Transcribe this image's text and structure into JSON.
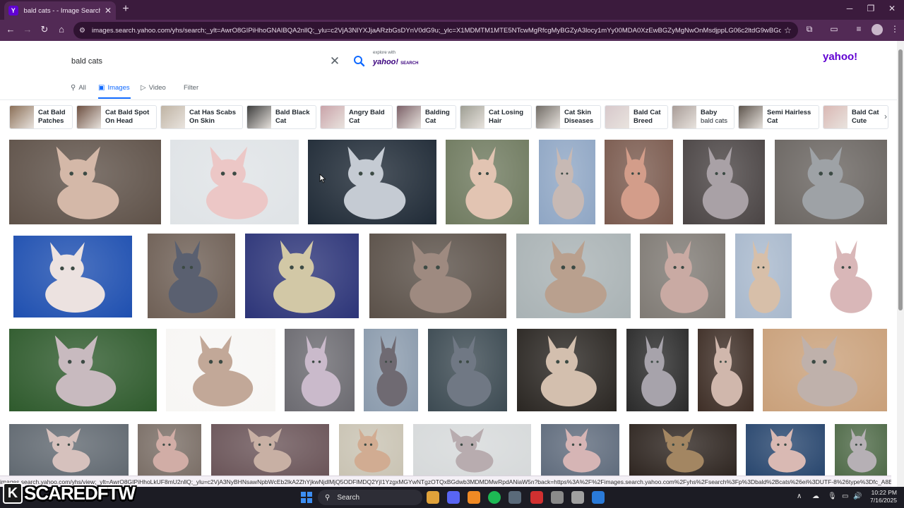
{
  "browser": {
    "tab_title": "bald cats - - Image Search Results",
    "favicon_letter": "Y",
    "url": "images.search.yahoo.com/yhs/search;_ylt=AwrO8GIPiHhoGNAIBQA2nllQ;_ylu=c2VjA3NlYXJjaARzbGsDYnV0dG9u;_ylc=X1MDMTM1MTE5NTcwMgRfcgMyBGZyA3locy1mYy00MDA0XzEwBGZyMgNwOnMsdjppLG06c2ltdG9wBGdwcmlkA...",
    "new_tab_label": "+",
    "window_controls": [
      "minimize-icon",
      "restore-icon",
      "close-icon"
    ]
  },
  "search": {
    "query": "bald cats",
    "clear_icon": "close-icon",
    "submit_icon": "search-icon",
    "explore_small": "explore with",
    "explore_brand": "yahoo!",
    "explore_brand_suffix": "SEARCH",
    "logo": "yahoo!"
  },
  "filters": [
    {
      "label": "All",
      "icon": "search-icon",
      "active": false
    },
    {
      "label": "Images",
      "icon": "image-icon",
      "active": true
    },
    {
      "label": "Video",
      "icon": "play-icon",
      "active": false
    },
    {
      "label": "Filter",
      "icon": "",
      "active": false
    }
  ],
  "chips": [
    {
      "line1": "Cat Bald",
      "line2": "Patches",
      "color": "#8a6e56"
    },
    {
      "line1": "Cat Bald Spot",
      "line2": "On Head",
      "color": "#6b4d3e"
    },
    {
      "line1": "Cat Has Scabs",
      "line2": "On Skin",
      "color": "#bfb3a3"
    },
    {
      "line1": "Bald Black",
      "line2": "Cat",
      "color": "#3a3a3a"
    },
    {
      "line1": "Angry Bald",
      "line2": "Cat",
      "color": "#c9a2a8"
    },
    {
      "line1": "Balding",
      "line2": "Cat",
      "color": "#7a5f66"
    },
    {
      "line1": "Cat Losing",
      "line2": "Hair",
      "color": "#9d9d92"
    },
    {
      "line1": "Cat Skin",
      "line2": "Diseases",
      "color": "#6f6a64"
    },
    {
      "line1": "Bald Cat",
      "line2": "Breed",
      "color": "#d7c8cb"
    },
    {
      "line1": "Baby",
      "line2": "bald cats",
      "color": "#a79b96",
      "line2_normal": true
    },
    {
      "line1": "Semi Hairless",
      "line2": "Cat",
      "color": "#5b524a"
    },
    {
      "line1": "Bald Cat",
      "line2": "Cute",
      "color": "#d9b7b3"
    }
  ],
  "chips_next_icon": "chevron-right-icon",
  "images": [
    {
      "name": "image-sphynx-1",
      "bg": "#5e5148",
      "cat": "#d4b8a8"
    },
    {
      "name": "image-sphynx-2",
      "bg": "#dfe3e6",
      "cat": "#ecc7c6"
    },
    {
      "name": "image-sphynx-3",
      "bg": "#1f2a36",
      "cat": "#c5cbd3"
    },
    {
      "name": "image-sphynx-4",
      "bg": "#6f7a5f",
      "cat": "#e2c4b2"
    },
    {
      "name": "image-sphynx-5",
      "bg": "#8fa6c4",
      "cat": "#c7b9b4"
    },
    {
      "name": "image-sphynx-6",
      "bg": "#7a5a4e",
      "cat": "#d39d8a"
    },
    {
      "name": "image-sphynx-7",
      "bg": "#4a4444",
      "cat": "#a9a1a6"
    },
    {
      "name": "image-sphynx-8",
      "bg": "#6a6561",
      "cat": "#9ea2a6"
    },
    {
      "name": "image-sphynx-9",
      "bg": "#1e4fb0",
      "cat": "#ece2e0"
    },
    {
      "name": "image-sphynx-10",
      "bg": "#6e5f55",
      "cat": "#5a6070"
    },
    {
      "name": "image-sphynx-11",
      "bg": "#2c3478",
      "cat": "#d2c8a6"
    },
    {
      "name": "image-sphynx-12",
      "bg": "#5a5048",
      "cat": "#9e8a80"
    },
    {
      "name": "image-sphynx-13",
      "bg": "#a9b2b4",
      "cat": "#b9a08e"
    },
    {
      "name": "image-sphynx-14",
      "bg": "#7f7a74",
      "cat": "#c9aaa3"
    },
    {
      "name": "image-sphynx-15",
      "bg": "#a8b8cc",
      "cat": "#d7bfa9"
    },
    {
      "name": "image-sphynx-16",
      "bg": "#ffffff",
      "cat": "#d9b7b8"
    },
    {
      "name": "image-sphynx-17",
      "bg": "#2e5a2c",
      "cat": "#c8babf"
    },
    {
      "name": "image-sphynx-18",
      "bg": "#f7f6f4",
      "cat": "#c2a898"
    },
    {
      "name": "image-sphynx-19",
      "bg": "#6b6a70",
      "cat": "#cabacb"
    },
    {
      "name": "image-sphynx-20",
      "bg": "#8a9aac",
      "cat": "#6f6a72"
    },
    {
      "name": "image-sphynx-21",
      "bg": "#3c4a52",
      "cat": "#707884"
    },
    {
      "name": "image-sphynx-22",
      "bg": "#2a2622",
      "cat": "#d3bfae"
    },
    {
      "name": "image-sphynx-23",
      "bg": "#2a2a2a",
      "cat": "#a7a3ab"
    },
    {
      "name": "image-sphynx-24",
      "bg": "#3e2e26",
      "cat": "#d0b7ac"
    },
    {
      "name": "image-sphynx-25",
      "bg": "#c9a07a",
      "cat": "#bfb1ab"
    },
    {
      "name": "image-sphynx-26",
      "bg": "#606870",
      "cat": "#d6c1bd"
    },
    {
      "name": "image-sphynx-27",
      "bg": "#7a6e66",
      "cat": "#d1ada6"
    },
    {
      "name": "image-sphynx-28",
      "bg": "#6a5458",
      "cat": "#c8b0a4"
    },
    {
      "name": "image-sphynx-29",
      "bg": "#c9c3b3",
      "cat": "#d1ac92"
    },
    {
      "name": "image-sphynx-30",
      "bg": "#d6d9da",
      "cat": "#b8acaf"
    },
    {
      "name": "image-sphynx-31",
      "bg": "#5f6b7c",
      "cat": "#d6b5b5"
    },
    {
      "name": "image-sphynx-32",
      "bg": "#2e2520",
      "cat": "#a38662"
    },
    {
      "name": "image-sphynx-33",
      "bg": "#28466e",
      "cat": "#d9b9b3"
    },
    {
      "name": "image-sphynx-34",
      "bg": "#4f6a48",
      "cat": "#b6b0b5"
    }
  ],
  "status_url": "images.search.yahoo.com/yhs/view;_ylt=AwrO8GIPiHhoLkUF8mU2nllQ;_ylu=c2VjA3NyBHNsawNpbWcEb2lkA2ZhYjkwNjdlMjQ5ODFlMDQ2YjI1YzgxMGYwNTgzOTQxBGdwb3MDMDMwRpdANiaW5n?back=https%3A%2F%2Fimages.search.yahoo.com%2Fyhs%2Fsearch%3Fp%3Dbald%2Bcats%26ei%3DUTF-8%26type%3Dfc_A8E8726288_s58_g_e_d_n...",
  "watermark": {
    "badge": "K",
    "text": "SCAREDFTW"
  },
  "taskbar": {
    "search_label": "Search",
    "time": "10:22 PM",
    "date": "7/16/2025",
    "apps": [
      {
        "name": "chrome-icon",
        "color": "#e0a23a"
      },
      {
        "name": "discord-icon",
        "color": "#5865f2"
      },
      {
        "name": "app-orange-icon",
        "color": "#f08a24"
      },
      {
        "name": "spotify-icon",
        "color": "#1db954"
      },
      {
        "name": "steam-icon",
        "color": "#5a6a7a"
      },
      {
        "name": "app-red-icon",
        "color": "#d13030"
      },
      {
        "name": "app-ghost-icon",
        "color": "#8a8a8a"
      },
      {
        "name": "app-gray-icon",
        "color": "#a0a0a0"
      },
      {
        "name": "app-blue-icon",
        "color": "#2a7ad8"
      }
    ]
  }
}
